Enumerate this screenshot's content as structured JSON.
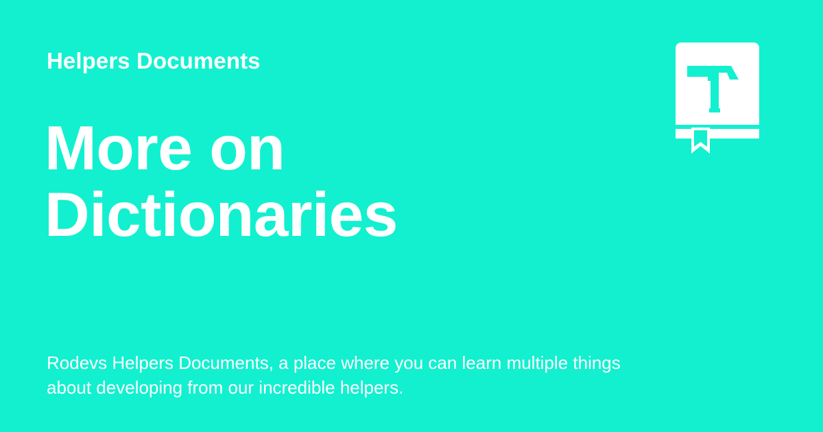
{
  "card": {
    "site_name": "Helpers Documents",
    "title_line_1": "More on",
    "title_line_2": "Dictionaries",
    "description": "Rodevs Helpers Documents, a place where you can learn multiple things about developing from our incredible helpers."
  },
  "logo": {
    "icon": "book-hammer-icon"
  },
  "colors": {
    "background": "#12F0D0",
    "foreground": "#FFFFFF"
  }
}
